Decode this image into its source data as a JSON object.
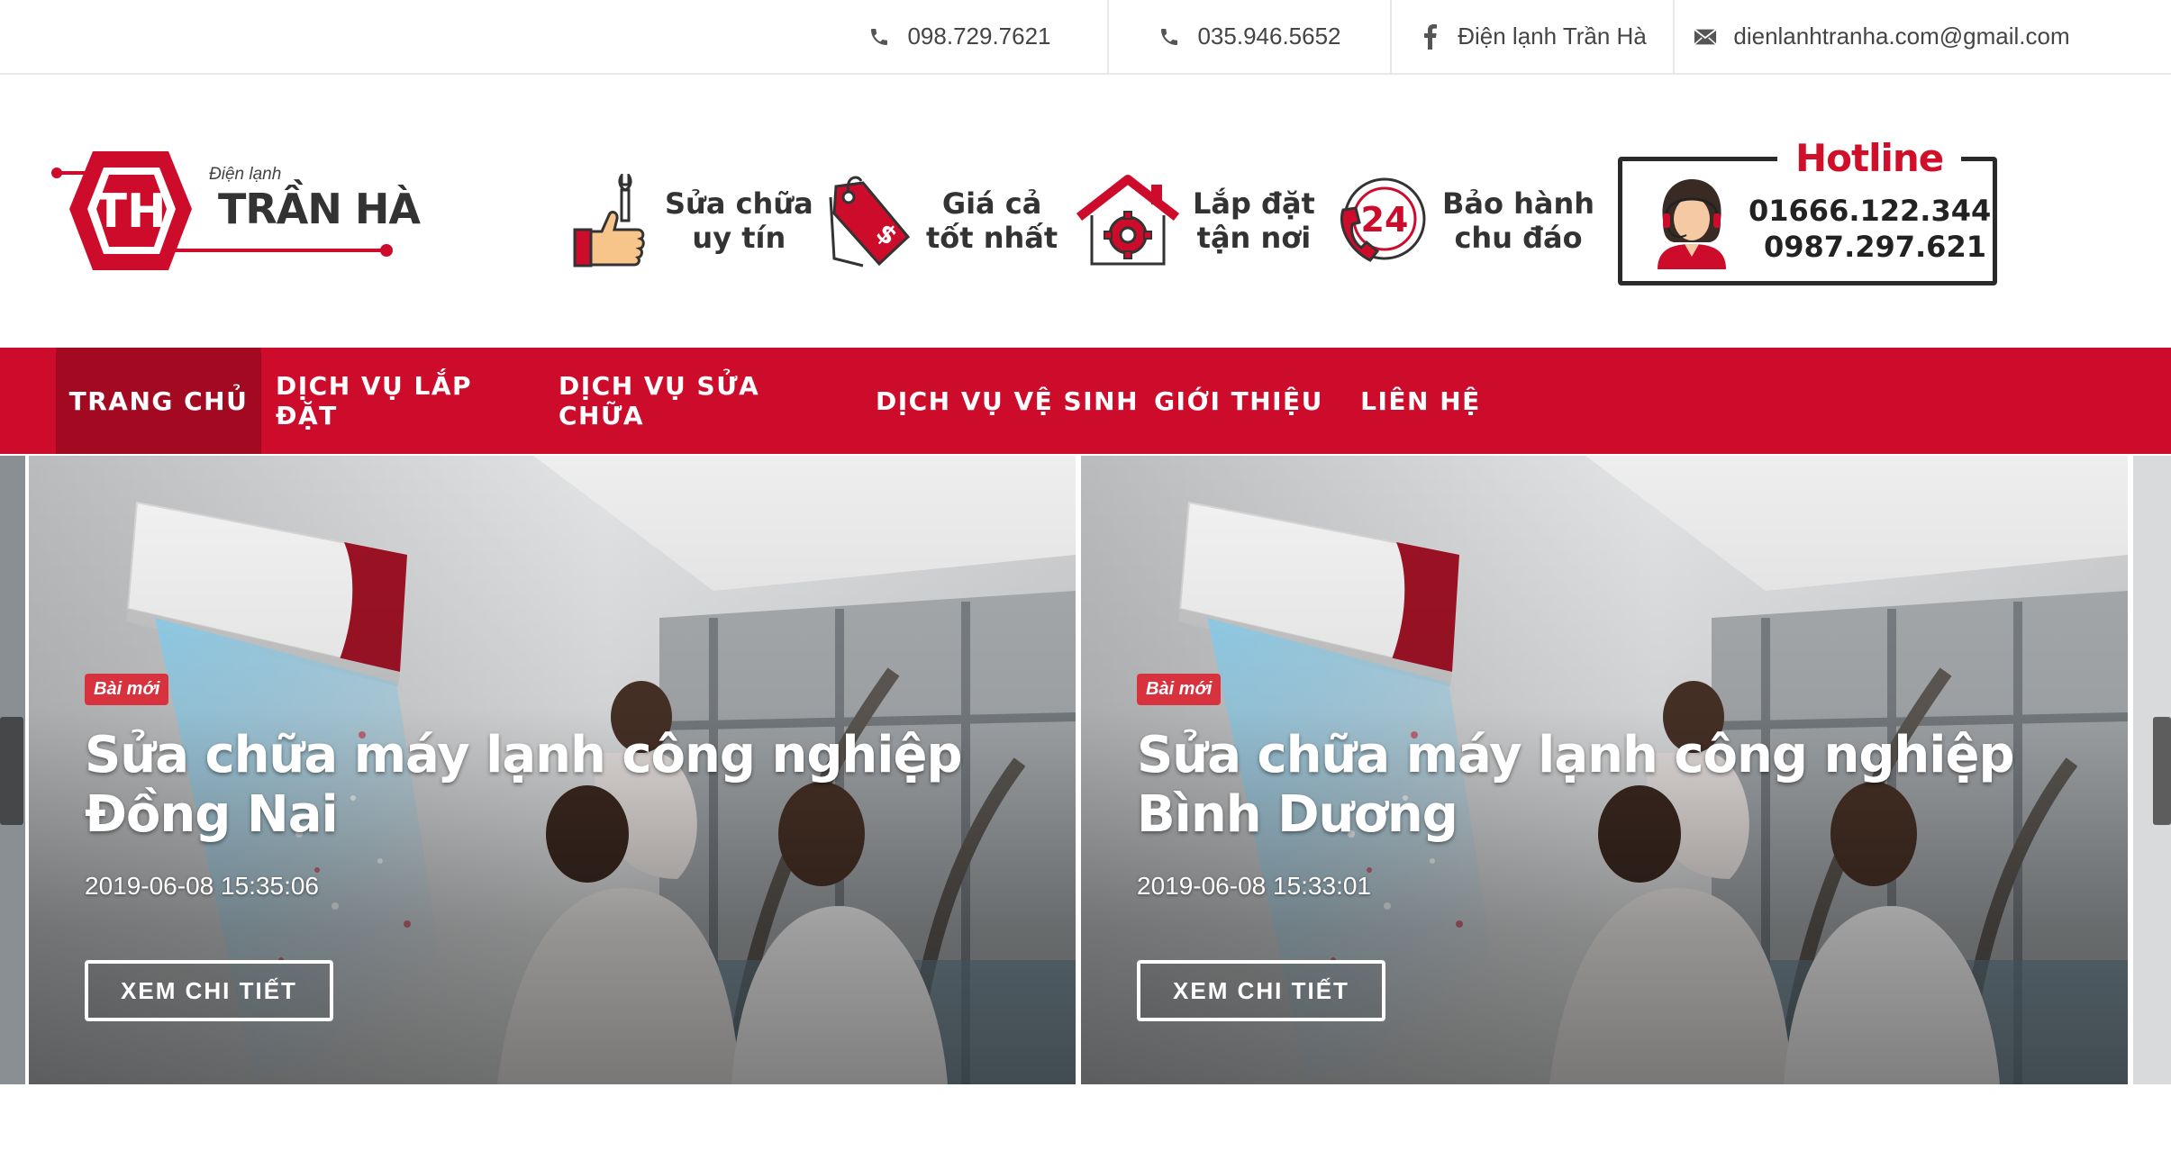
{
  "topbar": {
    "phone1": "098.729.7621",
    "phone2": "035.946.5652",
    "facebook": "Điện lạnh Trần Hà",
    "email": "dienlanhtranha.com@gmail.com"
  },
  "logo": {
    "small": "Điện lạnh",
    "big": "TRẦN HÀ",
    "mark": "TH"
  },
  "features": [
    {
      "line1": "Sửa chữa",
      "line2": "uy tín",
      "icon": "thumbs-up-wrench-icon"
    },
    {
      "line1": "Giá cả",
      "line2": "tốt nhất",
      "icon": "price-tag-icon"
    },
    {
      "line1": "Lắp đặt",
      "line2": "tận nơi",
      "icon": "house-gear-icon"
    },
    {
      "line1": "Bảo hành",
      "line2": "chu đáo",
      "icon": "support-24-icon"
    }
  ],
  "hotline": {
    "title": "Hotline",
    "num1": "01666.122.344",
    "num2": "0987.297.621"
  },
  "nav": [
    "TRANG CHỦ",
    "DỊCH VỤ LẮP ĐẶT",
    "DỊCH VỤ SỬA CHỮA",
    "DỊCH VỤ VỆ SINH",
    "GIỚI THIỆU",
    "LIÊN HỆ"
  ],
  "slides": [
    {
      "badge": "Bài mới",
      "title": "Sửa chữa máy lạnh công nghiệp Đồng Nai",
      "date": "2019-06-08 15:35:06",
      "button": "XEM CHI TIẾT"
    },
    {
      "badge": "Bài mới",
      "title": "Sửa chữa máy lạnh công nghiệp Bình Dương",
      "date": "2019-06-08 15:33:01",
      "button": "XEM CHI TIẾT"
    }
  ],
  "colors": {
    "brand_red": "#cd0c2b",
    "nav_active": "#a30a22",
    "badge": "#d9323f"
  }
}
